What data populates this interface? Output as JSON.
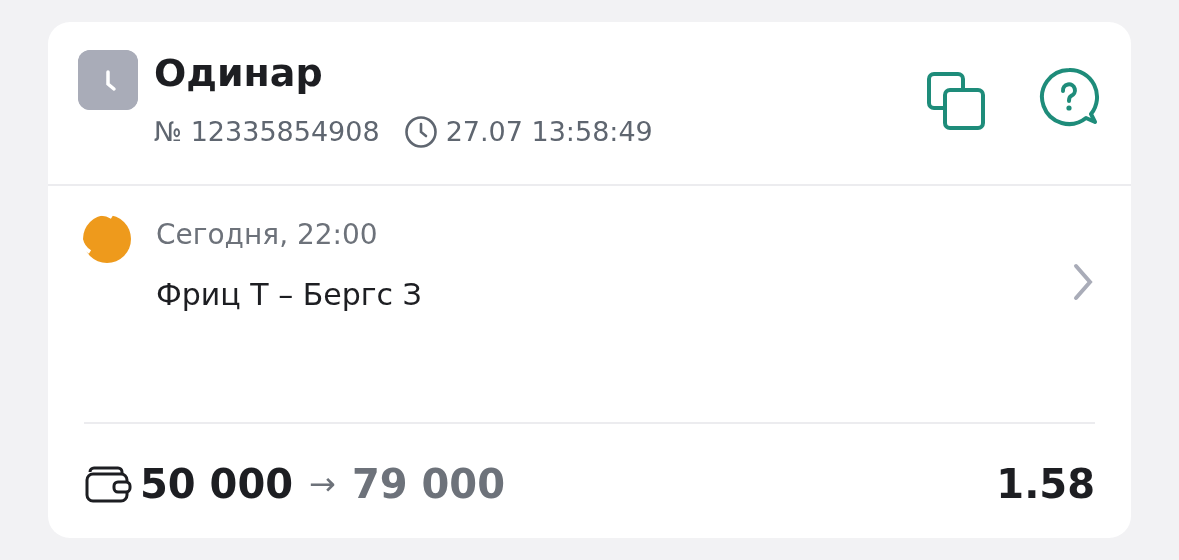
{
  "bet": {
    "type": "Одинар",
    "number": "№ 12335854908",
    "time": "27.07 13:58:49"
  },
  "events": [
    {
      "kind": "tennis",
      "date": "Сегодня, 22:00",
      "match": "Фриц Т – Бергс З"
    }
  ],
  "footer": {
    "stake": "50 000",
    "arrow": "→",
    "payout": "79 000",
    "odds": "1.58"
  }
}
